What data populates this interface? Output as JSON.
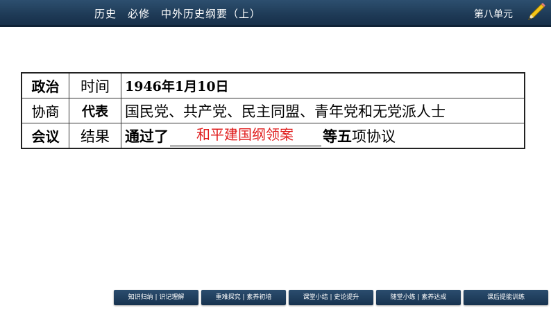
{
  "header": {
    "title": "历史　必修　中外历史纲要（上）",
    "unit": "第八单元"
  },
  "table": {
    "rowlabel": [
      "政治",
      "协商",
      "会议"
    ],
    "rows": [
      {
        "label": "时间",
        "value": "1946年1月10日"
      },
      {
        "label": "代表",
        "value": "国民党、共产党、民主同盟、青年党和无党派人士"
      },
      {
        "label": "结果",
        "prefix": "通过了",
        "answer": "和平建国纲领案",
        "suffix_bold": "等五",
        "suffix": "项协议"
      }
    ]
  },
  "nav": [
    "知识归纳 | 识记理解",
    "重难探究 | 素养初培",
    "课堂小结 | 史论提升",
    "随堂小练 | 素养达成",
    "课后提能训练"
  ]
}
